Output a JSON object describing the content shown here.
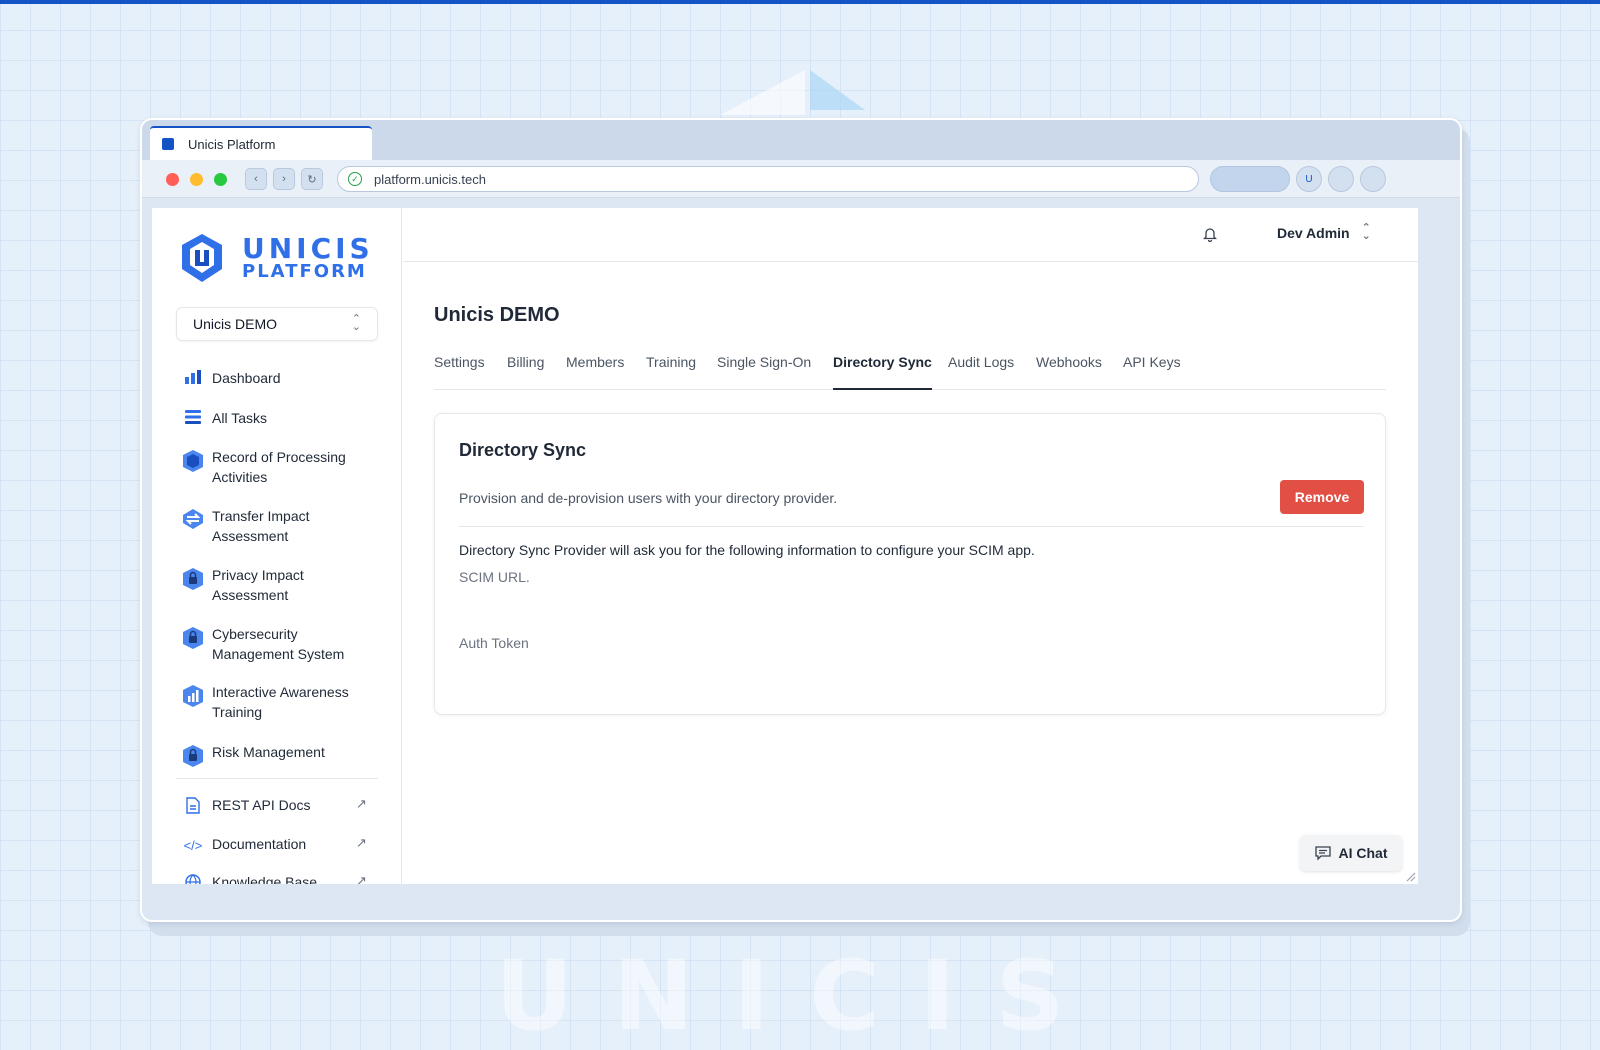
{
  "browser": {
    "tab_title": "Unicis Platform",
    "url": "platform.unicis.tech",
    "profile_initial": "U"
  },
  "background": {
    "watermark": "UNICIS"
  },
  "logo": {
    "line1": "UNICIS",
    "line2": "PLATFORM"
  },
  "org_selector": {
    "value": "Unicis DEMO"
  },
  "sidebar": {
    "items": [
      {
        "label": "Dashboard",
        "icon": "bar-chart-icon"
      },
      {
        "label": "All Tasks",
        "icon": "list-icon"
      },
      {
        "label": "Record of Processing Activities",
        "icon": "shield-icon"
      },
      {
        "label": "Transfer Impact Assessment",
        "icon": "transfer-icon"
      },
      {
        "label": "Privacy Impact Assessment",
        "icon": "lock-shield-icon"
      },
      {
        "label": "Cybersecurity Management System",
        "icon": "lock-shield-icon"
      },
      {
        "label": "Interactive Awareness Training",
        "icon": "training-icon"
      },
      {
        "label": "Risk Management",
        "icon": "lock-shield-icon"
      }
    ],
    "links": [
      {
        "label": "REST API Docs",
        "icon": "document-icon"
      },
      {
        "label": "Documentation",
        "icon": "code-icon"
      },
      {
        "label": "Knowledge Base",
        "icon": "globe-icon"
      }
    ]
  },
  "header": {
    "user_name": "Dev Admin"
  },
  "page": {
    "title": "Unicis DEMO",
    "tabs": [
      "Settings",
      "Billing",
      "Members",
      "Training",
      "Single Sign-On",
      "Directory Sync",
      "Audit Logs",
      "Webhooks",
      "API Keys"
    ],
    "active_tab": "Directory Sync"
  },
  "card": {
    "title": "Directory Sync",
    "description": "Provision and de-provision users with your directory provider.",
    "remove_label": "Remove",
    "info": "Directory Sync Provider will ask you for the following information to configure your SCIM app.",
    "field1": "SCIM URL.",
    "field2": "Auth Token"
  },
  "ai_chat": {
    "label": "AI Chat"
  },
  "colors": {
    "brand": "#2f6fe8",
    "danger": "#e14f45",
    "background": "#e6f0fa"
  }
}
